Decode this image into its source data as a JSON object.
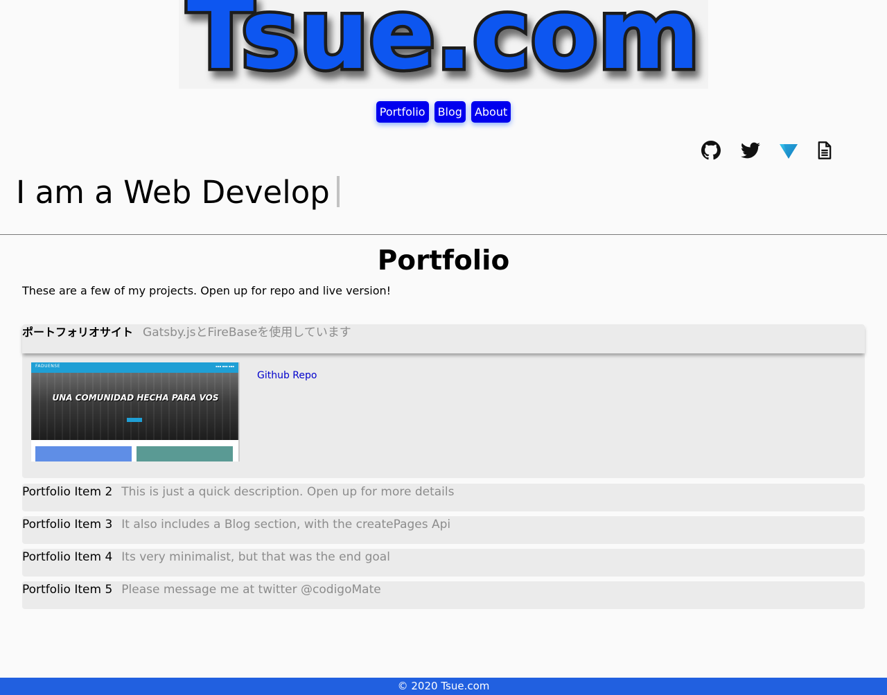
{
  "logo": {
    "text": "Tsue.com"
  },
  "nav": {
    "items": [
      {
        "label": "Portfolio"
      },
      {
        "label": "Blog"
      },
      {
        "label": "About"
      }
    ]
  },
  "social": {
    "icons": [
      "github-icon",
      "twitter-icon",
      "vercel-icon",
      "resume-document-icon"
    ]
  },
  "hero": {
    "typed_text": "I am a Web Develop"
  },
  "portfolio": {
    "title": "Portfolio",
    "intro": "These are a few of my projects. Open up for repo and live version!",
    "items": [
      {
        "title": "ポートフォリオサイト",
        "description": "Gatsby.jsとFireBaseを使用しています",
        "expanded": true,
        "repo_link": "Github Repo",
        "preview": {
          "brand": "FADUENSE",
          "hero_text": "UNA COMUNIDAD HECHA PARA VOS"
        }
      },
      {
        "title": "Portfolio Item 2",
        "description": "This is just a quick description. Open up for more details",
        "expanded": false
      },
      {
        "title": "Portfolio Item 3",
        "description": "It also includes a Blog section, with the createPages Api",
        "expanded": false
      },
      {
        "title": "Portfolio Item 4",
        "description": "Its very minimalist, but that was the end goal",
        "expanded": false
      },
      {
        "title": "Portfolio Item 5",
        "description": "Please message me at twitter @codigoMate",
        "expanded": false
      }
    ]
  },
  "footer": {
    "text": "© 2020 Tsue.com"
  },
  "colors": {
    "nav_button": "#0000ee",
    "footer": "#2160e0",
    "logo_blue": "#0a57f0",
    "panel": "#ebebeb",
    "link": "#0000cc"
  }
}
